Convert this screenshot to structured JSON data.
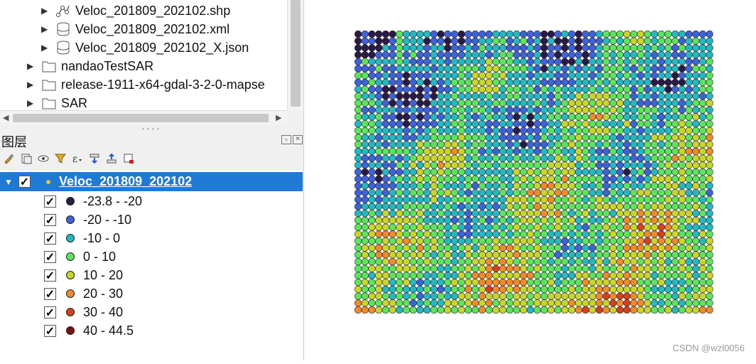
{
  "browser": {
    "items": [
      {
        "label": "Veloc_201809_202102.shp",
        "icon": "vector-point-icon"
      },
      {
        "label": "Veloc_201809_202102.xml",
        "icon": "database-icon"
      },
      {
        "label": "Veloc_201809_202102_X.json",
        "icon": "database-icon"
      },
      {
        "label": "nandaoTestSAR",
        "icon": "folder-icon"
      },
      {
        "label": "release-1911-x64-gdal-3-2-0-mapse",
        "icon": "folder-icon"
      },
      {
        "label": "SAR",
        "icon": "folder-icon"
      }
    ]
  },
  "layers_panel": {
    "title": "图层",
    "toolbar": [
      "paint-brush-icon",
      "add-group-icon",
      "eye-icon",
      "filter-icon",
      "expression-icon",
      "expand-all-icon",
      "collapse-all-icon",
      "remove-layer-icon"
    ],
    "layer": {
      "name": "Veloc_201809_202102",
      "checked": true,
      "legend": [
        {
          "label": "-23.8 - -20",
          "color": "#2a1a46"
        },
        {
          "label": "-20 - -10",
          "color": "#3e62d8"
        },
        {
          "label": "-10 - 0",
          "color": "#24b9c2"
        },
        {
          "label": "0 - 10",
          "color": "#5de45e"
        },
        {
          "label": "10 - 20",
          "color": "#c8d62a"
        },
        {
          "label": "20 - 30",
          "color": "#f08a2a"
        },
        {
          "label": "30 - 40",
          "color": "#d6401c"
        },
        {
          "label": "40 - 44.5",
          "color": "#7a1010"
        }
      ]
    }
  },
  "watermark": "CSDN @wzl0056"
}
